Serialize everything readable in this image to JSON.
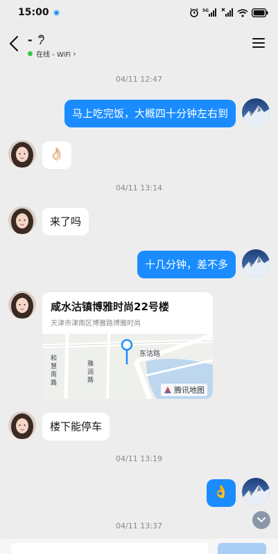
{
  "status_bar": {
    "time": "15:00"
  },
  "header": {
    "contact_name": "-",
    "online_status": "在线 - WiFi",
    "chevron": "›"
  },
  "messages": {
    "ts1": "04/11 12:47",
    "m1_text": "马上吃完饭，大概四十分钟左右到",
    "m2_emoji": "👌🏻",
    "ts2": "04/11 13:14",
    "m3_text": "来了吗",
    "m4_text": "十几分钟，差不多",
    "m5_location": {
      "title": "咸水沽镇博雅时尚22号楼",
      "address": "天津市津南区博雅路博雅时尚",
      "map_provider": "腾讯地图",
      "street_east": "东沽路",
      "street_west": "和 慧 南 路",
      "street_mid": "雅 润 路"
    },
    "m6_text": "楼下能停车",
    "ts3": "04/11 13:19",
    "m7_emoji": "👌",
    "ts4": "04/11 13:37"
  },
  "colors": {
    "accent": "#1a8cff",
    "background": "#ededed"
  }
}
